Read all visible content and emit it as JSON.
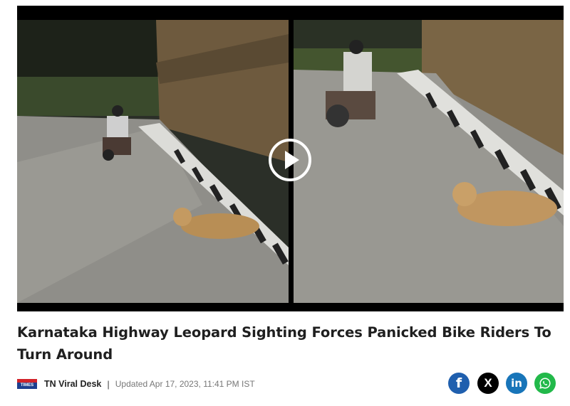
{
  "video": {
    "play_icon": "play-icon"
  },
  "article": {
    "headline": "Karnataka Highway Leopard Sighting Forces Panicked Bike Riders To Turn Around",
    "publisher_logo_text": "TIMES NOW",
    "author": "TN Viral Desk",
    "separator": "|",
    "updated": "Updated Apr 17, 2023, 11:41 PM IST"
  },
  "share": {
    "facebook": "f",
    "x": "X",
    "linkedin": "in",
    "whatsapp_icon": "whatsapp-icon"
  },
  "colors": {
    "facebook": "#1f5fae",
    "x": "#000000",
    "linkedin": "#1875b9",
    "whatsapp": "#22b94a"
  }
}
